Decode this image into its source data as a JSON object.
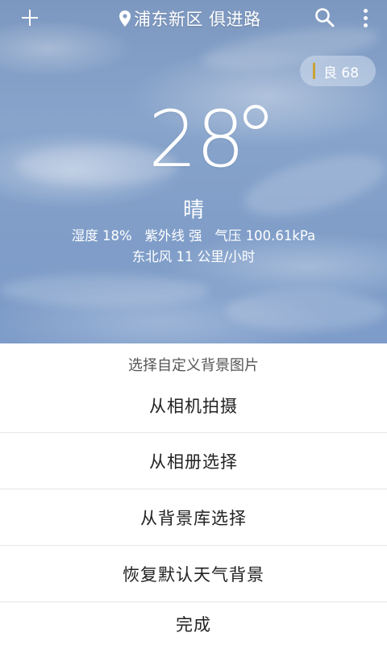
{
  "header": {
    "location": "浦东新区 俱进路",
    "add_icon": "plus-icon",
    "location_icon": "map-pin-icon",
    "search_icon": "search-icon",
    "menu_icon": "more-vertical-icon"
  },
  "weather": {
    "aqi": "良 68",
    "aqi_color": "#c8a233",
    "temperature": "28",
    "degree_symbol": "°",
    "condition": "晴",
    "details": "湿度 18%   紫外线 强   气压 100.61kPa",
    "wind": "东北风 11 公里/小时"
  },
  "sheet": {
    "title": "选择自定义背景图片",
    "options": [
      "从相机拍摄",
      "从相册选择",
      "从背景库选择",
      "恢复默认天气背景",
      "完成"
    ]
  }
}
